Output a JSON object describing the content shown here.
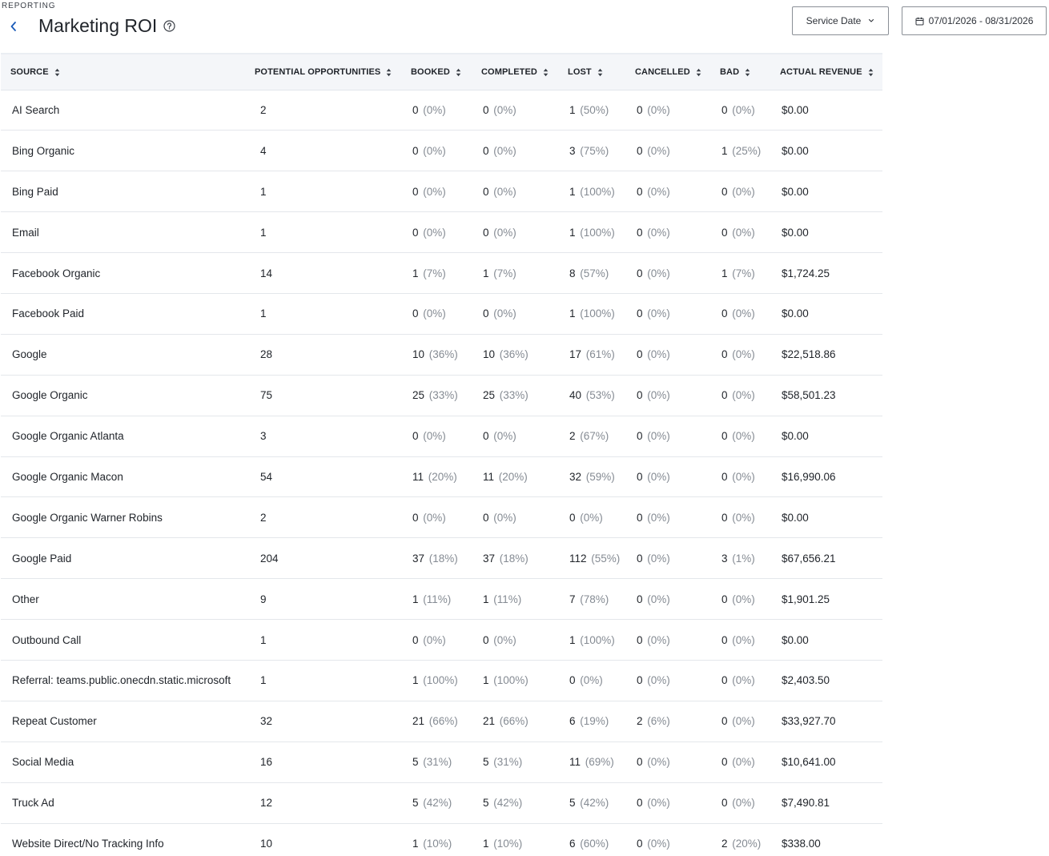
{
  "header": {
    "eyebrow": "REPORTING",
    "title": "Marketing ROI",
    "date_type_label": "Service Date",
    "date_range_label": "07/01/2026 - 08/31/2026",
    "accent_color": "#1a5bb8"
  },
  "table": {
    "columns": [
      {
        "key": "source",
        "label": "SOURCE"
      },
      {
        "key": "potential",
        "label": "POTENTIAL OPPORTUNITIES"
      },
      {
        "key": "booked",
        "label": "BOOKED"
      },
      {
        "key": "completed",
        "label": "COMPLETED"
      },
      {
        "key": "lost",
        "label": "LOST"
      },
      {
        "key": "cancelled",
        "label": "CANCELLED"
      },
      {
        "key": "bad",
        "label": "BAD"
      },
      {
        "key": "revenue",
        "label": "ACTUAL REVENUE"
      }
    ],
    "rows": [
      {
        "source": "AI Search",
        "potential": "2",
        "booked": [
          "0",
          "(0%)"
        ],
        "completed": [
          "0",
          "(0%)"
        ],
        "lost": [
          "1",
          "(50%)"
        ],
        "cancelled": [
          "0",
          "(0%)"
        ],
        "bad": [
          "0",
          "(0%)"
        ],
        "revenue": "$0.00"
      },
      {
        "source": "Bing Organic",
        "potential": "4",
        "booked": [
          "0",
          "(0%)"
        ],
        "completed": [
          "0",
          "(0%)"
        ],
        "lost": [
          "3",
          "(75%)"
        ],
        "cancelled": [
          "0",
          "(0%)"
        ],
        "bad": [
          "1",
          "(25%)"
        ],
        "revenue": "$0.00"
      },
      {
        "source": "Bing Paid",
        "potential": "1",
        "booked": [
          "0",
          "(0%)"
        ],
        "completed": [
          "0",
          "(0%)"
        ],
        "lost": [
          "1",
          "(100%)"
        ],
        "cancelled": [
          "0",
          "(0%)"
        ],
        "bad": [
          "0",
          "(0%)"
        ],
        "revenue": "$0.00"
      },
      {
        "source": "Email",
        "potential": "1",
        "booked": [
          "0",
          "(0%)"
        ],
        "completed": [
          "0",
          "(0%)"
        ],
        "lost": [
          "1",
          "(100%)"
        ],
        "cancelled": [
          "0",
          "(0%)"
        ],
        "bad": [
          "0",
          "(0%)"
        ],
        "revenue": "$0.00"
      },
      {
        "source": "Facebook Organic",
        "potential": "14",
        "booked": [
          "1",
          "(7%)"
        ],
        "completed": [
          "1",
          "(7%)"
        ],
        "lost": [
          "8",
          "(57%)"
        ],
        "cancelled": [
          "0",
          "(0%)"
        ],
        "bad": [
          "1",
          "(7%)"
        ],
        "revenue": "$1,724.25"
      },
      {
        "source": "Facebook Paid",
        "potential": "1",
        "booked": [
          "0",
          "(0%)"
        ],
        "completed": [
          "0",
          "(0%)"
        ],
        "lost": [
          "1",
          "(100%)"
        ],
        "cancelled": [
          "0",
          "(0%)"
        ],
        "bad": [
          "0",
          "(0%)"
        ],
        "revenue": "$0.00"
      },
      {
        "source": "Google",
        "potential": "28",
        "booked": [
          "10",
          "(36%)"
        ],
        "completed": [
          "10",
          "(36%)"
        ],
        "lost": [
          "17",
          "(61%)"
        ],
        "cancelled": [
          "0",
          "(0%)"
        ],
        "bad": [
          "0",
          "(0%)"
        ],
        "revenue": "$22,518.86"
      },
      {
        "source": "Google Organic",
        "potential": "75",
        "booked": [
          "25",
          "(33%)"
        ],
        "completed": [
          "25",
          "(33%)"
        ],
        "lost": [
          "40",
          "(53%)"
        ],
        "cancelled": [
          "0",
          "(0%)"
        ],
        "bad": [
          "0",
          "(0%)"
        ],
        "revenue": "$58,501.23"
      },
      {
        "source": "Google Organic Atlanta",
        "potential": "3",
        "booked": [
          "0",
          "(0%)"
        ],
        "completed": [
          "0",
          "(0%)"
        ],
        "lost": [
          "2",
          "(67%)"
        ],
        "cancelled": [
          "0",
          "(0%)"
        ],
        "bad": [
          "0",
          "(0%)"
        ],
        "revenue": "$0.00"
      },
      {
        "source": "Google Organic Macon",
        "potential": "54",
        "booked": [
          "11",
          "(20%)"
        ],
        "completed": [
          "11",
          "(20%)"
        ],
        "lost": [
          "32",
          "(59%)"
        ],
        "cancelled": [
          "0",
          "(0%)"
        ],
        "bad": [
          "0",
          "(0%)"
        ],
        "revenue": "$16,990.06"
      },
      {
        "source": "Google Organic Warner Robins",
        "potential": "2",
        "booked": [
          "0",
          "(0%)"
        ],
        "completed": [
          "0",
          "(0%)"
        ],
        "lost": [
          "0",
          "(0%)"
        ],
        "cancelled": [
          "0",
          "(0%)"
        ],
        "bad": [
          "0",
          "(0%)"
        ],
        "revenue": "$0.00"
      },
      {
        "source": "Google Paid",
        "potential": "204",
        "booked": [
          "37",
          "(18%)"
        ],
        "completed": [
          "37",
          "(18%)"
        ],
        "lost": [
          "112",
          "(55%)"
        ],
        "cancelled": [
          "0",
          "(0%)"
        ],
        "bad": [
          "3",
          "(1%)"
        ],
        "revenue": "$67,656.21"
      },
      {
        "source": "Other",
        "potential": "9",
        "booked": [
          "1",
          "(11%)"
        ],
        "completed": [
          "1",
          "(11%)"
        ],
        "lost": [
          "7",
          "(78%)"
        ],
        "cancelled": [
          "0",
          "(0%)"
        ],
        "bad": [
          "0",
          "(0%)"
        ],
        "revenue": "$1,901.25"
      },
      {
        "source": "Outbound Call",
        "potential": "1",
        "booked": [
          "0",
          "(0%)"
        ],
        "completed": [
          "0",
          "(0%)"
        ],
        "lost": [
          "1",
          "(100%)"
        ],
        "cancelled": [
          "0",
          "(0%)"
        ],
        "bad": [
          "0",
          "(0%)"
        ],
        "revenue": "$0.00"
      },
      {
        "source": "Referral: teams.public.onecdn.static.microsoft",
        "potential": "1",
        "booked": [
          "1",
          "(100%)"
        ],
        "completed": [
          "1",
          "(100%)"
        ],
        "lost": [
          "0",
          "(0%)"
        ],
        "cancelled": [
          "0",
          "(0%)"
        ],
        "bad": [
          "0",
          "(0%)"
        ],
        "revenue": "$2,403.50"
      },
      {
        "source": "Repeat Customer",
        "potential": "32",
        "booked": [
          "21",
          "(66%)"
        ],
        "completed": [
          "21",
          "(66%)"
        ],
        "lost": [
          "6",
          "(19%)"
        ],
        "cancelled": [
          "2",
          "(6%)"
        ],
        "bad": [
          "0",
          "(0%)"
        ],
        "revenue": "$33,927.70"
      },
      {
        "source": "Social Media",
        "potential": "16",
        "booked": [
          "5",
          "(31%)"
        ],
        "completed": [
          "5",
          "(31%)"
        ],
        "lost": [
          "11",
          "(69%)"
        ],
        "cancelled": [
          "0",
          "(0%)"
        ],
        "bad": [
          "0",
          "(0%)"
        ],
        "revenue": "$10,641.00"
      },
      {
        "source": "Truck Ad",
        "potential": "12",
        "booked": [
          "5",
          "(42%)"
        ],
        "completed": [
          "5",
          "(42%)"
        ],
        "lost": [
          "5",
          "(42%)"
        ],
        "cancelled": [
          "0",
          "(0%)"
        ],
        "bad": [
          "0",
          "(0%)"
        ],
        "revenue": "$7,490.81"
      },
      {
        "source": "Website Direct/No Tracking Info",
        "potential": "10",
        "booked": [
          "1",
          "(10%)"
        ],
        "completed": [
          "1",
          "(10%)"
        ],
        "lost": [
          "6",
          "(60%)"
        ],
        "cancelled": [
          "0",
          "(0%)"
        ],
        "bad": [
          "2",
          "(20%)"
        ],
        "revenue": "$338.00"
      }
    ]
  },
  "icons": {
    "back": "chevron-left-icon",
    "help": "question-circle-icon",
    "dropdown": "chevron-down-icon",
    "calendar": "calendar-icon",
    "sort": "sort-up-down-icon"
  }
}
